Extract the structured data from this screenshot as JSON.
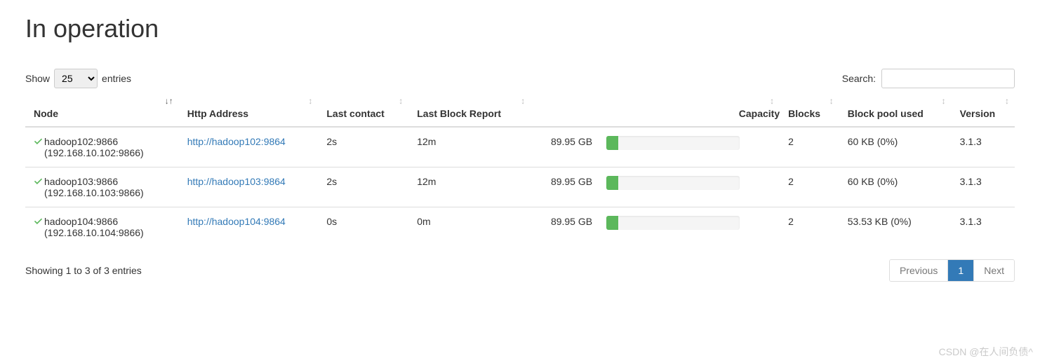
{
  "title": "In operation",
  "length": {
    "show_label": "Show",
    "entries_label": "entries",
    "selected": "25"
  },
  "search": {
    "label": "Search:",
    "value": ""
  },
  "columns": {
    "node": "Node",
    "http": "Http Address",
    "last_contact": "Last contact",
    "last_block": "Last Block Report",
    "capacity": "Capacity",
    "blocks": "Blocks",
    "block_pool": "Block pool used",
    "version": "Version"
  },
  "rows": [
    {
      "node_name": "hadoop102:9866",
      "node_ip": "(192.168.10.102:9866)",
      "http": "http://hadoop102:9864",
      "last_contact": "2s",
      "last_block": "12m",
      "capacity_text": "89.95 GB",
      "capacity_pct": 9,
      "blocks": "2",
      "block_pool": "60 KB (0%)",
      "version": "3.1.3"
    },
    {
      "node_name": "hadoop103:9866",
      "node_ip": "(192.168.10.103:9866)",
      "http": "http://hadoop103:9864",
      "last_contact": "2s",
      "last_block": "12m",
      "capacity_text": "89.95 GB",
      "capacity_pct": 9,
      "blocks": "2",
      "block_pool": "60 KB (0%)",
      "version": "3.1.3"
    },
    {
      "node_name": "hadoop104:9866",
      "node_ip": "(192.168.10.104:9866)",
      "http": "http://hadoop104:9864",
      "last_contact": "0s",
      "last_block": "0m",
      "capacity_text": "89.95 GB",
      "capacity_pct": 9,
      "blocks": "2",
      "block_pool": "53.53 KB (0%)",
      "version": "3.1.3"
    }
  ],
  "info_text": "Showing 1 to 3 of 3 entries",
  "pagination": {
    "previous": "Previous",
    "next": "Next",
    "current": "1"
  },
  "watermark": "CSDN @在人间负债^"
}
